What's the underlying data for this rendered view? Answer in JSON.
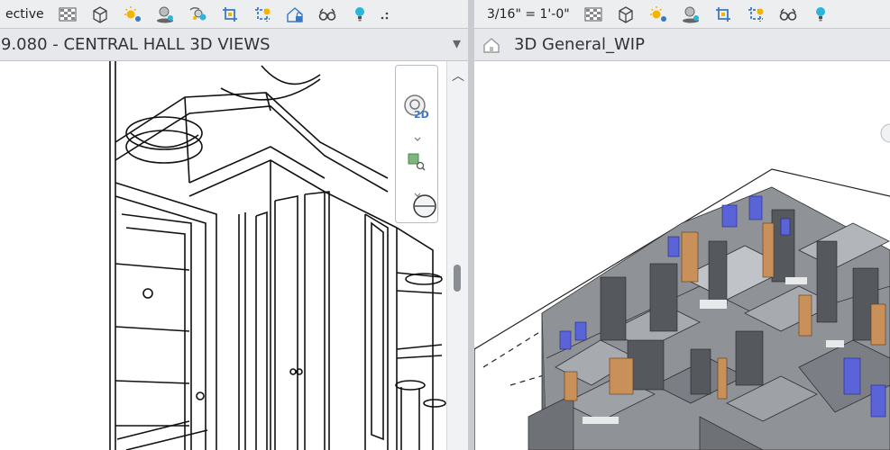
{
  "left": {
    "view_mode_label": "ective",
    "view_title": "9.080 - CENTRAL HALL 3D VIEWS",
    "tab_menu_glyph": "▾",
    "scroll_up_glyph": "︿",
    "navbar": {
      "wheel_label": "2D"
    }
  },
  "right": {
    "scale_label": "3/16\" = 1'-0\"",
    "view_title": "3D General_WIP"
  },
  "toolbar_icons": [
    "visual-style-icon",
    "crop-region-icon",
    "sun-path-icon",
    "shadows-icon",
    "render-icon",
    "crop-view-icon",
    "show-crop-icon",
    "unlock-view-icon",
    "temporary-hide-icon",
    "reveal-hidden-icon"
  ],
  "colors": {
    "accent_blue": "#3b78c4",
    "sun_yellow": "#f5b400",
    "bulb_cyan": "#2bb6d9",
    "model_grey": "#7b7f85",
    "wood": "#c9905a",
    "glass": "#5a64d8"
  }
}
